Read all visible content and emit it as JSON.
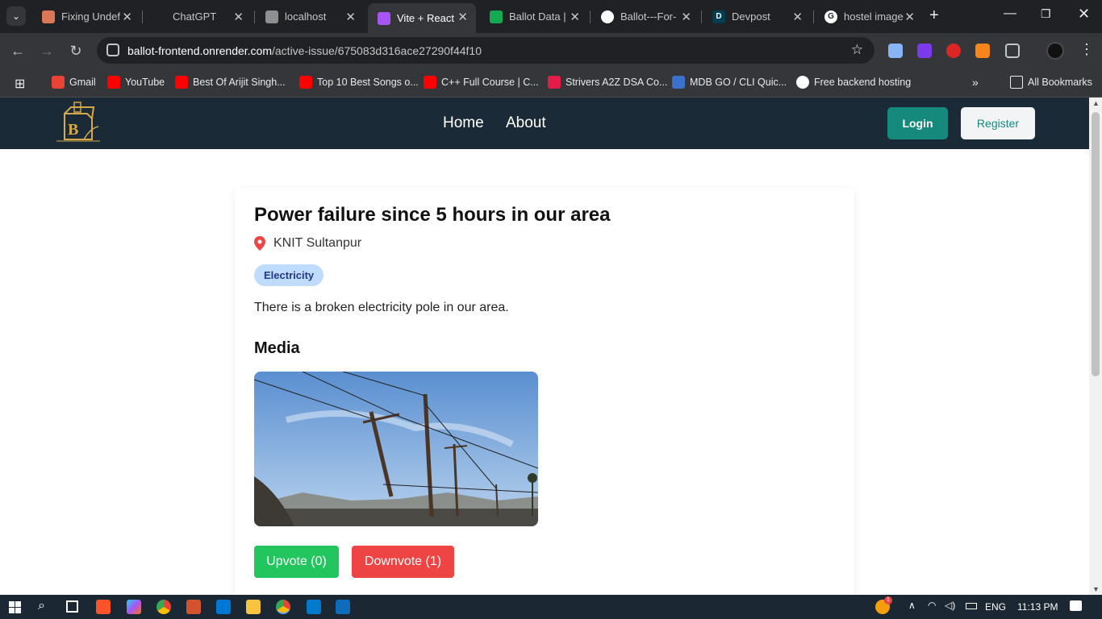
{
  "browser": {
    "tabs": [
      {
        "title": "Fixing Undef",
        "icon": "claude-icon",
        "color": "#d97757"
      },
      {
        "title": "ChatGPT",
        "icon": "chatgpt-icon",
        "color": "#202124"
      },
      {
        "title": "localhost",
        "icon": "vite-icon",
        "color": "#8f8f8f"
      },
      {
        "title": "Vite + React",
        "icon": "vite-icon",
        "color": "#a855f7",
        "active": true
      },
      {
        "title": "Ballot Data |",
        "icon": "mongodb-icon",
        "color": "#13aa52"
      },
      {
        "title": "Ballot---For-",
        "icon": "github-icon",
        "color": "#ffffff"
      },
      {
        "title": "Devpost",
        "icon": "devpost-icon",
        "color": "#003e54",
        "glyph": "D"
      },
      {
        "title": "hostel image",
        "icon": "google-icon",
        "color": "#ffffff",
        "glyph": "G"
      }
    ],
    "url_host": "ballot-frontend.onrender.com",
    "url_path": "/active-issue/675083d316ace27290f44f10",
    "bookmarks": [
      {
        "label": "Gmail",
        "icon": "gmail-icon",
        "color": "#ea4335"
      },
      {
        "label": "YouTube",
        "icon": "youtube-icon",
        "color": "#ff0000"
      },
      {
        "label": "Best Of Arijit Singh...",
        "icon": "youtube-icon",
        "color": "#ff0000"
      },
      {
        "label": "Top 10 Best Songs o...",
        "icon": "youtube-icon",
        "color": "#ff0000"
      },
      {
        "label": "C++ Full Course | C...",
        "icon": "youtube-icon",
        "color": "#ff0000"
      },
      {
        "label": "Strivers A2Z DSA Co...",
        "icon": "tuf-icon",
        "color": "#e11d48"
      },
      {
        "label": "MDB GO / CLI Quic...",
        "icon": "mdb-icon",
        "color": "#3b71ca"
      },
      {
        "label": "Free backend hosting",
        "icon": "github-icon",
        "color": "#ffffff"
      }
    ],
    "all_bookmarks": "All Bookmarks"
  },
  "site": {
    "nav": {
      "home": "Home",
      "about": "About"
    },
    "login": "Login",
    "register": "Register"
  },
  "issue": {
    "title": "Power failure since 5 hours in our area",
    "location": "KNIT Sultanpur",
    "category": "Electricity",
    "description": "There is a broken electricity pole in our area.",
    "media_heading": "Media",
    "upvote": "Upvote (0)",
    "downvote": "Downvote (1)"
  },
  "taskbar": {
    "lang": "ENG",
    "time": "11:13 PM",
    "notif_count": "1"
  },
  "colors": {
    "header_bg": "#1a2a36",
    "accent": "#14897c",
    "upvote": "#22c55e",
    "downvote": "#ef4444"
  }
}
